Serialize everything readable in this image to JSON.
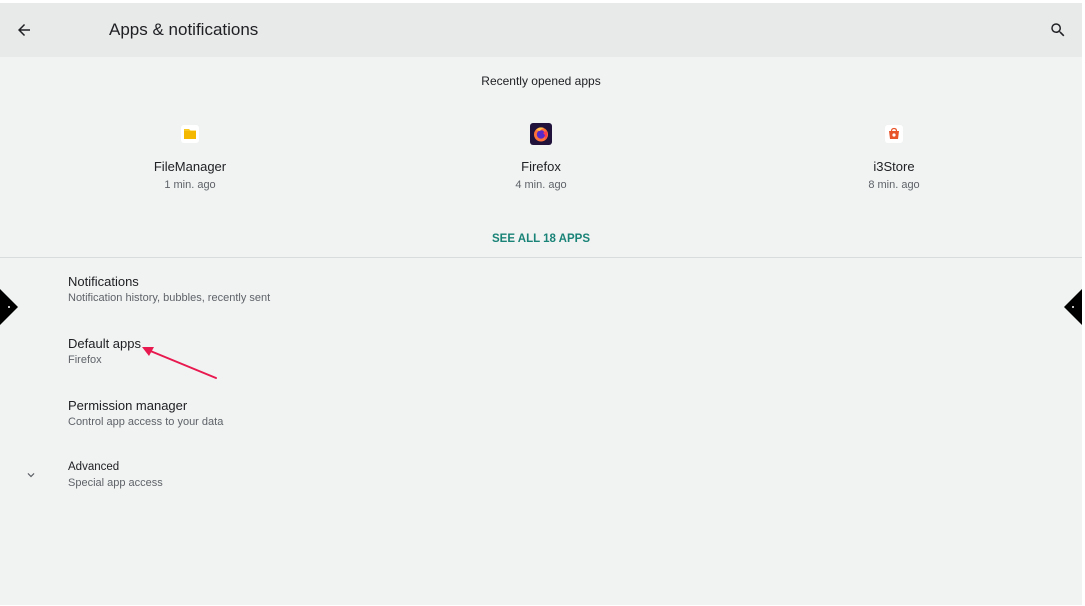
{
  "header": {
    "title": "Apps & notifications",
    "back_icon": "arrow-left-icon",
    "search_icon": "search-icon"
  },
  "recent": {
    "header": "Recently opened apps",
    "apps": [
      {
        "name": "FileManager",
        "time": "1 min. ago",
        "icon": "folder-icon",
        "color": "#f9c820"
      },
      {
        "name": "Firefox",
        "time": "4 min. ago",
        "icon": "firefox-icon",
        "color": "#ff7139"
      },
      {
        "name": "i3Store",
        "time": "8 min. ago",
        "icon": "store-icon",
        "color": "#e8552b"
      }
    ],
    "see_all": "SEE ALL 18 APPS"
  },
  "prefs": {
    "notifications": {
      "title": "Notifications",
      "summary": "Notification history, bubbles, recently sent"
    },
    "default_apps": {
      "title": "Default apps",
      "summary": "Firefox"
    },
    "permission_manager": {
      "title": "Permission manager",
      "summary": "Control app access to your data"
    },
    "advanced": {
      "title": "Advanced",
      "summary": "Special app access"
    }
  },
  "colors": {
    "accent": "#1a8377",
    "annotation": "#e8194f",
    "background": "#f1f3f3",
    "appbar": "#e8eaea"
  }
}
